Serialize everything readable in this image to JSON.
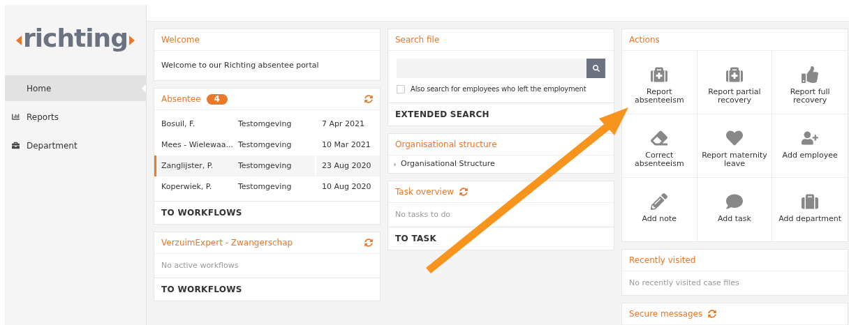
{
  "logo": "richting",
  "sidebar": {
    "items": [
      {
        "label": "Home",
        "selected": true
      },
      {
        "label": "Reports",
        "selected": false
      },
      {
        "label": "Department",
        "selected": false
      }
    ]
  },
  "welcome": {
    "title": "Welcome",
    "text": "Welcome to our Richting absentee portal"
  },
  "absentee": {
    "title": "Absentee",
    "count": "4",
    "rows": [
      {
        "name": "Bosuil, F.",
        "environment": "Testomgeving",
        "date": "7 Apr 2021",
        "selected": false
      },
      {
        "name": "Mees - Wielewaa...",
        "environment": "Testomgeving",
        "date": "10 Mar 2021",
        "selected": false
      },
      {
        "name": "Zanglijster, P.",
        "environment": "Testomgeving",
        "date": "23 Aug 2020",
        "selected": true
      },
      {
        "name": "Koperwiek, P.",
        "environment": "Testomgeving",
        "date": "10 Aug 2020",
        "selected": false
      }
    ],
    "link": "TO WORKFLOWS"
  },
  "verzuim": {
    "title": "VerzuimExpert - Zwangerschap",
    "empty": "No active workflows",
    "link": "TO WORKFLOWS"
  },
  "search_file": {
    "title": "Search file",
    "checkbox": {
      "label": "Also search for employees who left the employment",
      "checked": false
    },
    "link": "EXTENDED SEARCH"
  },
  "org_structure": {
    "title": "Organisational structure",
    "tree": [
      {
        "label": "Organisational Structure",
        "expanded": false
      }
    ]
  },
  "task_overview": {
    "title": "Task overview",
    "empty": "No tasks to do",
    "link": "TO TASK"
  },
  "actions": {
    "title": "Actions",
    "items": [
      {
        "label": "Report absenteeism"
      },
      {
        "label": "Report partial recovery"
      },
      {
        "label": "Report full recovery"
      },
      {
        "label": "Correct absenteeism"
      },
      {
        "label": "Report maternity leave"
      },
      {
        "label": "Add employee"
      },
      {
        "label": "Add note"
      },
      {
        "label": "Add task"
      },
      {
        "label": "Add department"
      }
    ]
  },
  "recently_visited": {
    "title": "Recently visited",
    "empty": "No recently visited case files"
  },
  "secure_messages": {
    "title": "Secure messages"
  }
}
